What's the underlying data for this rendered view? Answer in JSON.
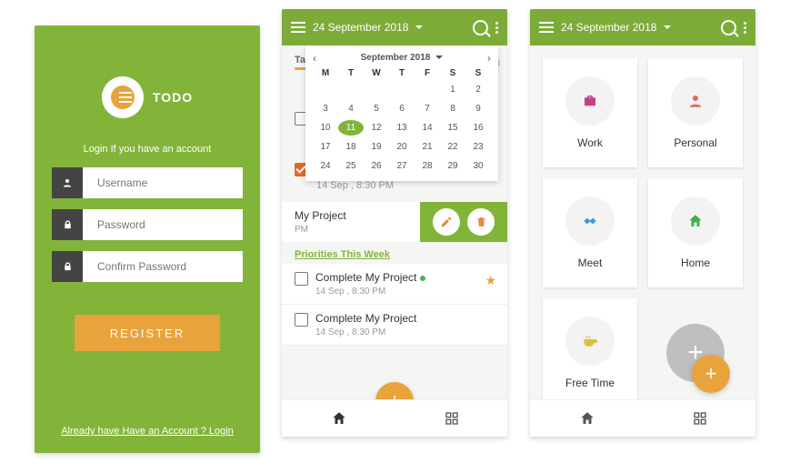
{
  "screen1": {
    "logo_text": "TODO",
    "subtitle": "Login If you have an account",
    "username_placeholder": "Username",
    "password_placeholder": "Password",
    "confirm_placeholder": "Confirm Password",
    "register_label": "REGISTER",
    "login_link": "Already have Have an Account ? Login"
  },
  "screen2": {
    "appbar_date": "24 September 2018",
    "calendar": {
      "month_label": "September 2018",
      "dow": [
        "M",
        "T",
        "W",
        "T",
        "F",
        "S",
        "S"
      ],
      "leading_blanks": 5,
      "days": 30,
      "selected": 11
    },
    "task_behind_meta": "14 Sep , 8:30 PM",
    "swiped": {
      "title": "My Project",
      "meta": "PM"
    },
    "section_label": "Priorities This Week",
    "tasks": [
      {
        "title": "Complete My Project",
        "meta": "14 Sep , 8:30 PM",
        "priority": true,
        "starred": true
      },
      {
        "title": "Complete My Project",
        "meta": "14 Sep , 8:30 PM",
        "priority": false,
        "starred": false
      }
    ],
    "right_number": "100"
  },
  "screen3": {
    "appbar_date": "24 September 2018",
    "categories": [
      {
        "label": "Work",
        "icon": "briefcase",
        "color": "#c7418a"
      },
      {
        "label": "Personal",
        "icon": "person",
        "color": "#e06a5a"
      },
      {
        "label": "Meet",
        "icon": "handshake",
        "color": "#3c9bd6"
      },
      {
        "label": "Home",
        "icon": "home",
        "color": "#3fb04f"
      },
      {
        "label": "Free Time",
        "icon": "cup",
        "color": "#d7c23a"
      }
    ]
  }
}
